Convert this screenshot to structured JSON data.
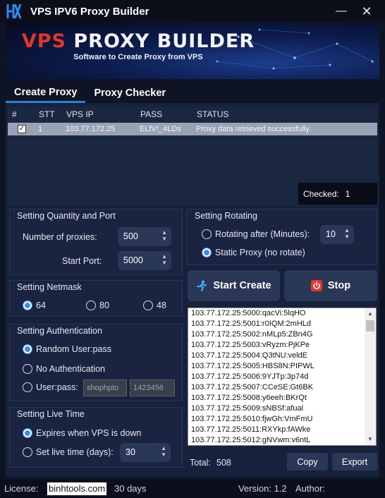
{
  "window": {
    "title": "VPS IPV6 Proxy Builder",
    "minimize_glyph": "—",
    "close_glyph": "✕",
    "logo_icon": "hx-logo-icon"
  },
  "banner": {
    "title_part1": "VPS ",
    "title_part2": "PROXY BUILDER",
    "subtitle": "Software to Create Proxy from VPS"
  },
  "tabs": [
    {
      "label": "Create Proxy",
      "active": true
    },
    {
      "label": "Proxy Checker",
      "active": false
    }
  ],
  "table": {
    "columns": [
      "#",
      "STT",
      "VPS IP",
      "PASS",
      "STATUS"
    ],
    "rows": [
      {
        "checked": true,
        "stt": "1",
        "ip": "103.77.172.25",
        "pass": "ELfV!_4LDs",
        "status": "Proxy data retrieved successfully."
      }
    ],
    "checked_label": "Checked:",
    "checked_count": "1"
  },
  "quantity_port": {
    "title": "Setting Quantity and Port",
    "proxies_label": "Number of proxies:",
    "proxies_value": "500",
    "start_port_label": "Start Port:",
    "start_port_value": "5000"
  },
  "rotating": {
    "title": "Setting Rotating",
    "rotating_label": "Rotating after (Minutes):",
    "rotating_value": "10",
    "static_label": "Static Proxy (no rotate)",
    "selected": "static"
  },
  "netmask": {
    "title": "Setting Netmask",
    "options": [
      "64",
      "80",
      "48"
    ],
    "selected": "64"
  },
  "authentication": {
    "title": "Setting Authentication",
    "random_label": "Random User:pass",
    "none_label": "No Authentication",
    "userpass_label": "User:pass:",
    "user_value": "shophpto",
    "pass_value": "1423456",
    "selected": "random"
  },
  "live_time": {
    "title": "Setting Live Time",
    "expires_label": "Expires when VPS is down",
    "set_label": "Set live time (days):",
    "days_value": "30",
    "selected": "expires"
  },
  "actions": {
    "start_label": "Start Create",
    "stop_label": "Stop",
    "start_icon": "runner-icon",
    "stop_icon": "power-icon"
  },
  "proxy_list": [
    "103.77.172.25:5000:qacVi:5lqHO",
    "103.77.172.25:5001:r0IQM:2mHLd",
    "103.77.172.25:5002:nMLp5:ZBn4G",
    "103.77.172.25:5003:vRyzm:PjKPe",
    "103.77.172.25:5004:Q3tNU:veldE",
    "103.77.172.25:5005:HBS8N:PIPWL",
    "103.77.172.25:5006:9YJTp:3p74d",
    "103.77.172.25:5007:CCeSE:Gt6BK",
    "103.77.172.25:5008:y6eeh:BKrQt",
    "103.77.172.25:5009:sNBSf:afual",
    "103.77.172.25:5010:fjwGh:VmFmU",
    "103.77.172.25:5011:RXYkp:fAWke",
    "103.77.172.25:5012:gNVwm:v6ntL"
  ],
  "totals": {
    "total_label": "Total:",
    "total_value": "508",
    "copy_label": "Copy",
    "export_label": "Export"
  },
  "statusbar": {
    "license_label": "License:",
    "license_value": "binhtools.com",
    "days": "30 days",
    "version": "Version: 1.2",
    "author_label": "Author:"
  }
}
